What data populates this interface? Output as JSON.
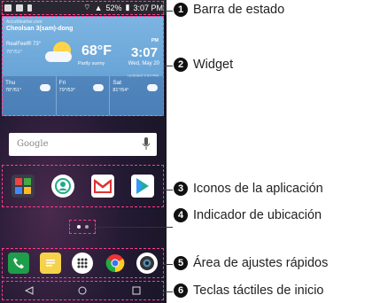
{
  "status_bar": {
    "battery": "52%",
    "time": "3:07 PM"
  },
  "widget": {
    "source": "AccuWeather.com",
    "location": "Cheolsan 3(sam)-dong",
    "realfeel": "RealFeel® 73°",
    "hilo": "70°/51°",
    "temperature": "68°F",
    "condition": "Partly sunny",
    "ampm": "PM",
    "time": "3:07",
    "date": "Wed, May 20",
    "updated": "Updated 2:54 PM",
    "forecast": [
      {
        "day": "Thu",
        "temps": "78°/51°"
      },
      {
        "day": "Fri",
        "temps": "79°/53°"
      },
      {
        "day": "Sat",
        "temps": "81°/54°"
      }
    ]
  },
  "search": {
    "placeholder": "Google"
  },
  "callouts": [
    {
      "num": "1",
      "label": "Barra de estado"
    },
    {
      "num": "2",
      "label": "Widget"
    },
    {
      "num": "3",
      "label": "Iconos de la aplicación"
    },
    {
      "num": "4",
      "label": "Indicador de ubicación"
    },
    {
      "num": "5",
      "label": "Área de ajustes rápidos"
    },
    {
      "num": "6",
      "label": "Teclas táctiles de inicio"
    }
  ],
  "colors": {
    "highlight": "#ff3c8c",
    "widget_bg": "#6aa6d8"
  }
}
